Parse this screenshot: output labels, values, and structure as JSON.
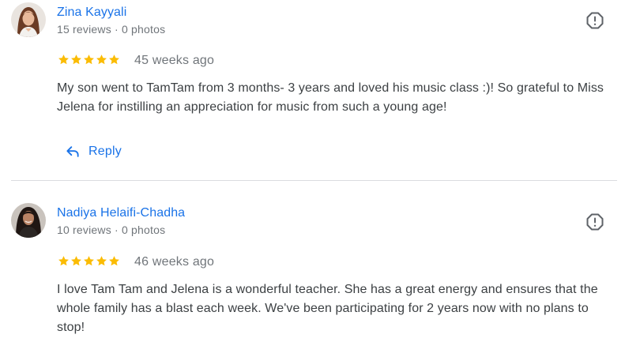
{
  "reviews": [
    {
      "author": "Zina Kayyali",
      "meta": "15 reviews · 0 photos",
      "rating": 5,
      "date": "45 weeks ago",
      "text": "My son went to TamTam from 3 months- 3 years and loved his music class :)! So grateful to Miss Jelena for instilling an appreciation for music from such a young age!",
      "reply_label": "Reply"
    },
    {
      "author": "Nadiya Helaifi-Chadha",
      "meta": "10 reviews · 0 photos",
      "rating": 5,
      "date": "46 weeks ago",
      "text": "I love Tam Tam and Jelena is a wonderful teacher. She has a great energy and ensures that the whole family has a blast each week. We've been participating for 2 years now with no plans to stop!"
    }
  ],
  "icons": {
    "star": "star-icon",
    "flag": "report-flag-icon",
    "reply": "reply-arrow-icon"
  },
  "colors": {
    "link": "#1a73e8",
    "star": "#fbbc04",
    "muted": "#70757a",
    "text": "#3c4043",
    "divider": "#dadce0"
  }
}
